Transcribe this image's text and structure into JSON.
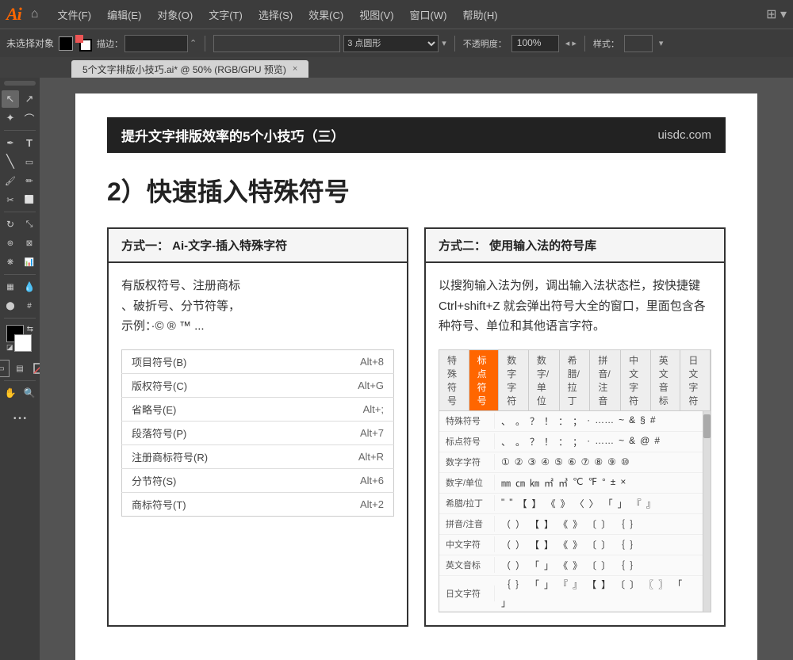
{
  "app": {
    "logo": "Ai",
    "home_icon": "⌂"
  },
  "menu": {
    "items": [
      "文件(F)",
      "编辑(E)",
      "对象(O)",
      "文字(T)",
      "选择(S)",
      "效果(C)",
      "视图(V)",
      "窗口(W)",
      "帮助(H)"
    ]
  },
  "toolbar": {
    "label": "未选择对象",
    "stroke_label": "描边：",
    "point_label": "3 点圆形",
    "opacity_label": "不透明度：",
    "opacity_value": "100%",
    "style_label": "样式：",
    "grid_icon": "⊞"
  },
  "tab": {
    "title": "5个文字排版小技巧.ai* @ 50% (RGB/GPU 预览)",
    "close": "×"
  },
  "document": {
    "header_title": "提升文字排版效率的5个小技巧（三）",
    "header_site": "uisdc.com",
    "section_title": "2）快速插入特殊符号",
    "col1": {
      "header": "方式一：  Ai-文字-插入特殊字符",
      "desc": "有版权符号、注册商标\n、破折号、分节符等，\n示例：·© ® ™ ...",
      "menu_items": [
        {
          "label": "项目符号(B)",
          "shortcut": "Alt+8"
        },
        {
          "label": "版权符号(C)",
          "shortcut": "Alt+G"
        },
        {
          "label": "省略号(E)",
          "shortcut": "Alt+;"
        },
        {
          "label": "段落符号(P)",
          "shortcut": "Alt+7"
        },
        {
          "label": "注册商标符号(R)",
          "shortcut": "Alt+R"
        },
        {
          "label": "分节符(S)",
          "shortcut": "Alt+6"
        },
        {
          "label": "商标符号(T)",
          "shortcut": "Alt+2"
        }
      ]
    },
    "col2": {
      "header": "方式二：  使用输入法的符号库",
      "desc": "以搜狗输入法为例，调出输入法状态栏，按快捷键 Ctrl+shift+Z 就会弹出符号大全的窗口，里面包含各种符号、单位和其他语言字符。",
      "categories": [
        "特殊符号",
        "标点符号",
        "数字字符",
        "数字/单位",
        "希腊/拉丁",
        "拼音/注音",
        "中文字符",
        "英文音标",
        "日文字符"
      ],
      "active_cat": "标点符号",
      "rows": [
        {
          "label": "特殊符号",
          "chars": [
            "、",
            "。",
            "？",
            "！",
            "：",
            "；",
            "·",
            "……",
            "~",
            "&",
            "§",
            "#"
          ]
        },
        {
          "label": "标点符号",
          "chars": [
            "、",
            "。",
            "？",
            "！",
            "：",
            "；",
            "·",
            "……",
            "~",
            "&",
            "@",
            "#"
          ]
        },
        {
          "label": "数字字符",
          "chars": [
            "①",
            "②",
            "③",
            "④",
            "⑤",
            "⑥",
            "⑦",
            "⑧",
            "⑨",
            "⑩"
          ]
        },
        {
          "label": "数字/单位",
          "chars": [
            "㎜",
            "㎝",
            "㎞",
            "㎡",
            "㎥",
            "℃",
            "℉",
            "°",
            "±",
            "×"
          ]
        },
        {
          "label": "希腊/拉丁",
          "chars": [
            "\"",
            "\"",
            "【",
            "】",
            "《",
            "》",
            "〈",
            "〉",
            "「",
            "」",
            "『",
            "』"
          ]
        },
        {
          "label": "拼音/注音",
          "chars": [
            "（",
            "）",
            "【",
            "】",
            "《",
            "》",
            "〔",
            "〕",
            "｛",
            "｝"
          ]
        },
        {
          "label": "中文字符",
          "chars": [
            "（",
            "）",
            "【",
            "】",
            "《",
            "》",
            "〔",
            "〕",
            "｛",
            "｝"
          ]
        },
        {
          "label": "英文音标",
          "chars": [
            "（",
            "）",
            "「",
            "」",
            "《",
            "》",
            "〔",
            "〕",
            "｛",
            "｝"
          ]
        },
        {
          "label": "日文字符",
          "chars": [
            "｛",
            "｝",
            "「",
            "」",
            "『",
            "』",
            "【",
            "】",
            "〔",
            "〕",
            "〖",
            "〗",
            "「",
            "」"
          ]
        }
      ]
    }
  },
  "tools": [
    {
      "icon": "↖",
      "name": "select-tool"
    },
    {
      "icon": "↗",
      "name": "direct-select-tool"
    },
    {
      "icon": "✎",
      "name": "pen-tool"
    },
    {
      "icon": "T",
      "name": "type-tool"
    },
    {
      "icon": "/",
      "name": "line-tool"
    },
    {
      "icon": "◻",
      "name": "rect-tool"
    },
    {
      "icon": "✂",
      "name": "scissors-tool"
    },
    {
      "icon": "↻",
      "name": "rotate-tool"
    },
    {
      "icon": "⊛",
      "name": "blend-tool"
    },
    {
      "icon": "✦",
      "name": "transform-tool"
    },
    {
      "icon": "⊕",
      "name": "symbol-tool"
    },
    {
      "icon": "📊",
      "name": "graph-tool"
    },
    {
      "icon": "✏",
      "name": "pencil-tool"
    },
    {
      "icon": "✋",
      "name": "hand-tool"
    },
    {
      "icon": "🔍",
      "name": "zoom-tool"
    }
  ]
}
